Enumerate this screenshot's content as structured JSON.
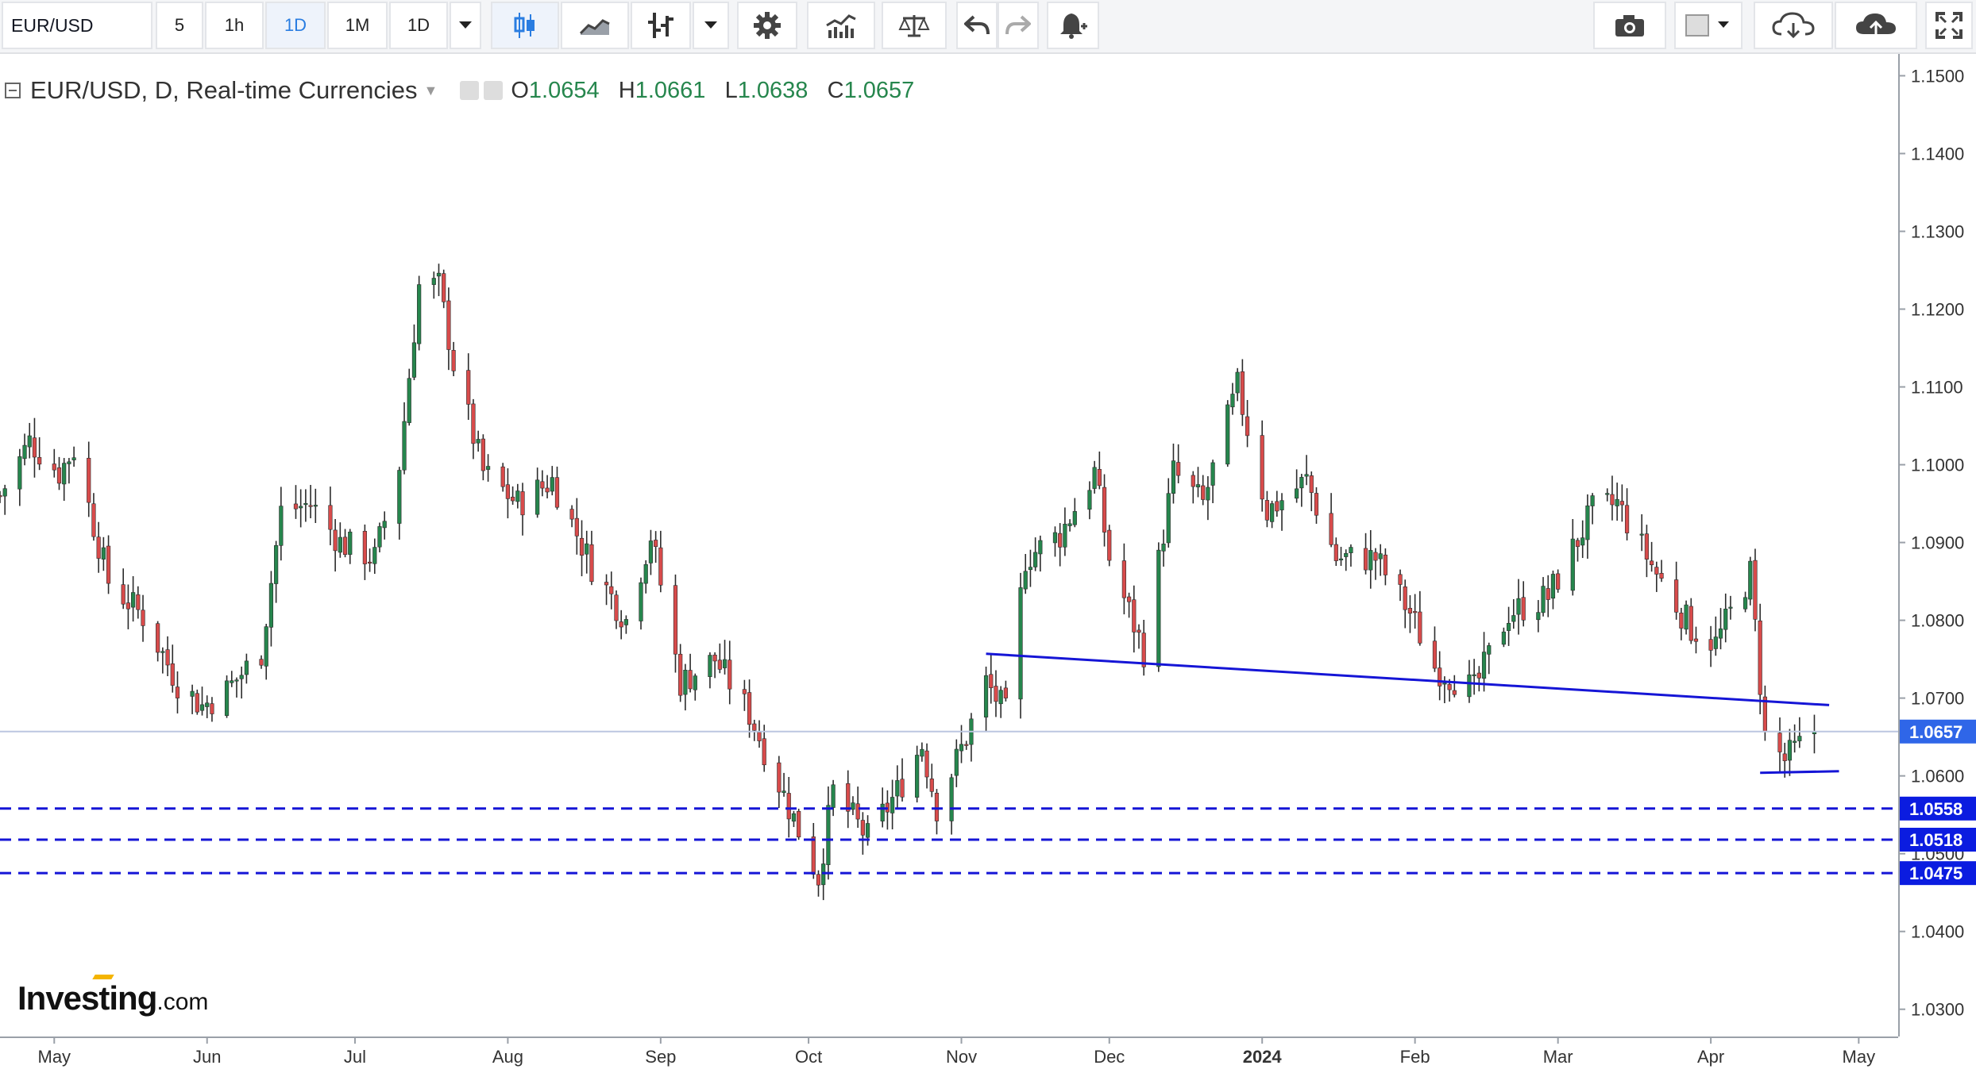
{
  "toolbar": {
    "symbol": "EUR/USD",
    "intervals": [
      "5",
      "1h",
      "1D",
      "1M",
      "1D"
    ],
    "active_interval_index": 2
  },
  "legend": {
    "title": "EUR/USD, D, Real-time Currencies",
    "open_label": "O",
    "open": "1.0654",
    "high_label": "H",
    "high": "1.0661",
    "low_label": "L",
    "low": "1.0638",
    "close_label": "C",
    "close": "1.0657"
  },
  "logo": {
    "brand": "Investing",
    "suffix": ".com"
  },
  "colors": {
    "up": "#26864d",
    "down": "#d84b4b",
    "trendline": "#1515d6",
    "last_price_line": "#bcc6e0",
    "last_price_badge": "#2f66e8",
    "level_badge": "#0b1ce0"
  },
  "chart_data": {
    "type": "candlestick",
    "symbol": "EUR/USD",
    "timeframe": "D",
    "x_range": [
      "2023-04-20",
      "2024-05-09"
    ],
    "ylim": [
      1.0265,
      1.1528
    ],
    "y_ticks": [
      1.03,
      1.04,
      1.05,
      1.06,
      1.07,
      1.08,
      1.09,
      1.1,
      1.11,
      1.12,
      1.13,
      1.14,
      1.15
    ],
    "y_tick_labels": [
      "1.0300",
      "1.0400",
      "1.0500",
      "1.0600",
      "1.0700",
      "1.0800",
      "1.0900",
      "1.1000",
      "1.1100",
      "1.1200",
      "1.1300",
      "1.1400",
      "1.1500"
    ],
    "x_ticks": [
      {
        "label": "May",
        "date": "2023-05-01",
        "bold": false
      },
      {
        "label": "Jun",
        "date": "2023-06-01",
        "bold": false
      },
      {
        "label": "Jul",
        "date": "2023-07-01",
        "bold": false
      },
      {
        "label": "Aug",
        "date": "2023-08-01",
        "bold": false
      },
      {
        "label": "Sep",
        "date": "2023-09-01",
        "bold": false
      },
      {
        "label": "Oct",
        "date": "2023-10-01",
        "bold": false
      },
      {
        "label": "Nov",
        "date": "2023-11-01",
        "bold": false
      },
      {
        "label": "Dec",
        "date": "2023-12-01",
        "bold": false
      },
      {
        "label": "2024",
        "date": "2024-01-01",
        "bold": true
      },
      {
        "label": "Feb",
        "date": "2024-02-01",
        "bold": false
      },
      {
        "label": "Mar",
        "date": "2024-03-01",
        "bold": false
      },
      {
        "label": "Apr",
        "date": "2024-04-01",
        "bold": false
      },
      {
        "label": "May",
        "date": "2024-05-01",
        "bold": false
      }
    ],
    "close_anchors": [
      [
        "2023-04-20",
        1.096
      ],
      [
        "2023-04-26",
        1.103
      ],
      [
        "2023-05-02",
        1.099
      ],
      [
        "2023-05-05",
        1.102
      ],
      [
        "2023-05-12",
        1.085
      ],
      [
        "2023-05-19",
        1.0805
      ],
      [
        "2023-05-26",
        1.072
      ],
      [
        "2023-05-31",
        1.069
      ],
      [
        "2023-06-05",
        1.071
      ],
      [
        "2023-06-12",
        1.076
      ],
      [
        "2023-06-16",
        1.094
      ],
      [
        "2023-06-22",
        1.095
      ],
      [
        "2023-06-28",
        1.09
      ],
      [
        "2023-07-05",
        1.088
      ],
      [
        "2023-07-10",
        1.1
      ],
      [
        "2023-07-14",
        1.123
      ],
      [
        "2023-07-18",
        1.123
      ],
      [
        "2023-07-21",
        1.113
      ],
      [
        "2023-07-27",
        1.099
      ],
      [
        "2023-08-03",
        1.095
      ],
      [
        "2023-08-10",
        1.098
      ],
      [
        "2023-08-18",
        1.087
      ],
      [
        "2023-08-25",
        1.08
      ],
      [
        "2023-08-30",
        1.091
      ],
      [
        "2023-09-05",
        1.072
      ],
      [
        "2023-09-12",
        1.075
      ],
      [
        "2023-09-19",
        1.068
      ],
      [
        "2023-09-25",
        1.059
      ],
      [
        "2023-10-03",
        1.047
      ],
      [
        "2023-10-06",
        1.058
      ],
      [
        "2023-10-13",
        1.052
      ],
      [
        "2023-10-19",
        1.058
      ],
      [
        "2023-10-24",
        1.064
      ],
      [
        "2023-10-27",
        1.056
      ],
      [
        "2023-11-02",
        1.065
      ],
      [
        "2023-11-06",
        1.072
      ],
      [
        "2023-11-10",
        1.068
      ],
      [
        "2023-11-14",
        1.088
      ],
      [
        "2023-11-21",
        1.091
      ],
      [
        "2023-11-28",
        1.099
      ],
      [
        "2023-12-01",
        1.088
      ],
      [
        "2023-12-08",
        1.076
      ],
      [
        "2023-12-14",
        1.099
      ],
      [
        "2023-12-20",
        1.095
      ],
      [
        "2023-12-27",
        1.11
      ],
      [
        "2024-01-02",
        1.094
      ],
      [
        "2024-01-10",
        1.098
      ],
      [
        "2024-01-16",
        1.088
      ],
      [
        "2024-01-24",
        1.088
      ],
      [
        "2024-01-31",
        1.081
      ],
      [
        "2024-02-05",
        1.074
      ],
      [
        "2024-02-13",
        1.071
      ],
      [
        "2024-02-20",
        1.081
      ],
      [
        "2024-02-28",
        1.083
      ],
      [
        "2024-03-08",
        1.094
      ],
      [
        "2024-03-13",
        1.095
      ],
      [
        "2024-03-21",
        1.086
      ],
      [
        "2024-03-28",
        1.079
      ],
      [
        "2024-04-02",
        1.077
      ],
      [
        "2024-04-09",
        1.086
      ],
      [
        "2024-04-12",
        1.065
      ],
      [
        "2024-04-16",
        1.062
      ],
      [
        "2024-04-22",
        1.0657
      ]
    ],
    "trendlines": [
      {
        "from": [
          "2023-11-06",
          1.0757
        ],
        "to": [
          "2024-04-25",
          1.0691
        ],
        "style": "solid"
      },
      {
        "from": [
          "2024-04-11",
          1.0604
        ],
        "to": [
          "2024-04-27",
          1.0606
        ],
        "style": "solid"
      }
    ],
    "horizontal_levels": [
      {
        "value": 1.0558,
        "label": "1.0558",
        "style": "dashed"
      },
      {
        "value": 1.0518,
        "label": "1.0518",
        "style": "dashed"
      },
      {
        "value": 1.0475,
        "label": "1.0475",
        "style": "dashed"
      }
    ],
    "last_price": {
      "value": 1.0657,
      "label": "1.0657"
    },
    "grid": false,
    "legend": "top-left"
  }
}
